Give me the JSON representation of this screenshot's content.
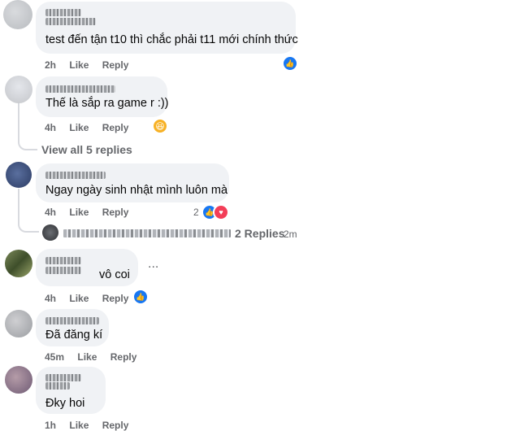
{
  "comments": [
    {
      "text": "test đến tận t10 thì chắc phải t11 mới chính thức",
      "time": "2h",
      "like": "Like",
      "reply": "Reply"
    },
    {
      "text": "Thế là sắp ra game r :))",
      "time": "4h",
      "like": "Like",
      "reply": "Reply"
    },
    {
      "view_replies": "View all 5 replies"
    },
    {
      "text": "Ngay ngày sinh nhật mình luôn mà",
      "time": "4h",
      "like": "Like",
      "reply": "Reply",
      "reaction_count": "2",
      "replies_label": "2 Replies",
      "replies_time": "2m"
    },
    {
      "text": "vô coi",
      "time": "4h",
      "like": "Like",
      "reply": "Reply",
      "more": "..."
    },
    {
      "text": "Đã đăng kí",
      "time": "45m",
      "like": "Like",
      "reply": "Reply"
    },
    {
      "text": "Đky hoi",
      "time": "1h",
      "like": "Like",
      "reply": "Reply"
    }
  ],
  "colors": {
    "like_blue": "#1877f2",
    "love_red": "#f33e58",
    "bubble": "#f0f2f5",
    "meta": "#65676b"
  }
}
